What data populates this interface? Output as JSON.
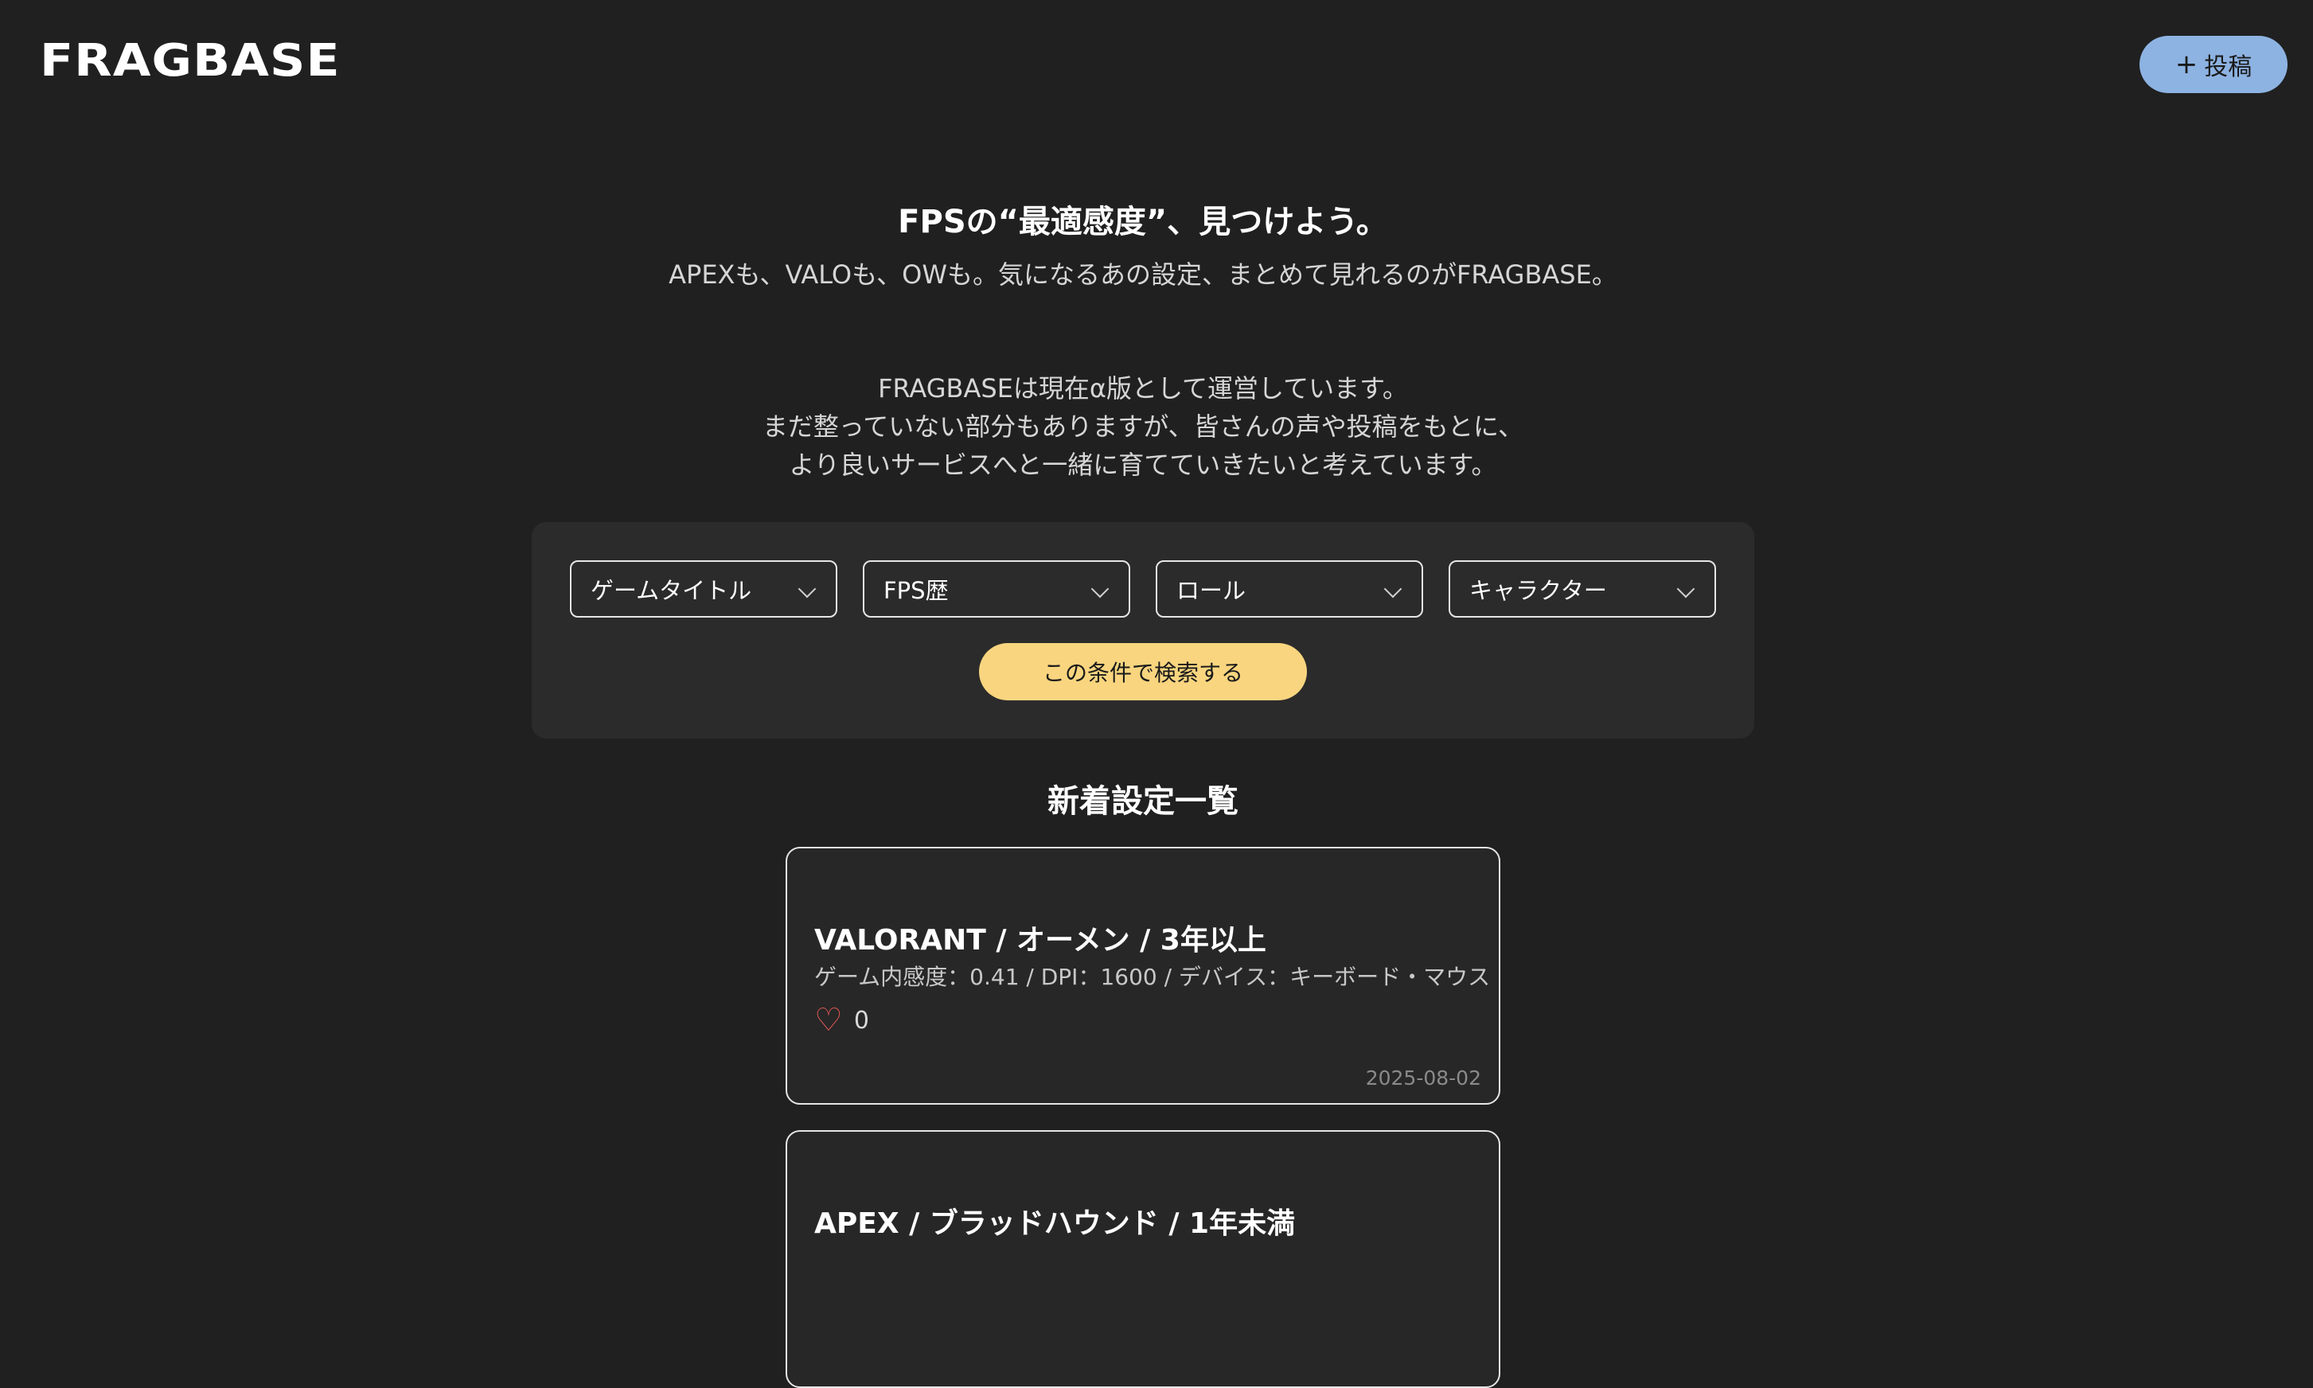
{
  "header": {
    "logo": "FRAGBASE",
    "post_button": {
      "icon": "plus-icon",
      "label": "投稿"
    }
  },
  "hero": {
    "title": "FPSの“最適感度”、見つけよう。",
    "subtitle": "APEXも、VALOも、OWも。気になるあの設定、まとめて見れるのがFRAGBASE。"
  },
  "notice": {
    "lines": [
      "FRAGBASEは現在α版として運営しています。",
      "まだ整っていない部分もありますが、皆さんの声や投稿をもとに、",
      "より良いサービスへと一緒に育てていきたいと考えています。"
    ]
  },
  "filters": {
    "selects": [
      {
        "selected": "ゲームタイトル"
      },
      {
        "selected": "FPS歴"
      },
      {
        "selected": "ロール"
      },
      {
        "selected": "キャラクター"
      }
    ],
    "search_button": "この条件で検索する"
  },
  "list": {
    "title": "新着設定一覧",
    "posts": [
      {
        "title": "VALORANT / オーメン / 3年以上",
        "meta": "ゲーム内感度：0.41 / DPI：1600 / デバイス：キーボード・マウス",
        "likes": "0",
        "date": "2025-08-02"
      },
      {
        "title": "APEX / ブラッドハウンド / 1年未満"
      }
    ]
  },
  "colors": {
    "background": "#202020",
    "panel": "#2b2b2b",
    "post_button": "#8db3e2",
    "search_button": "#f9d57f",
    "heart": "#e05555"
  }
}
